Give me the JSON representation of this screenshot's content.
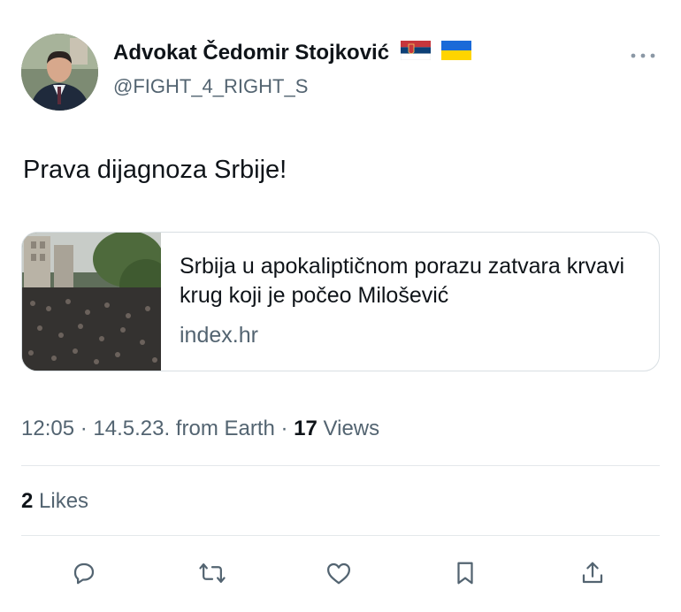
{
  "author": {
    "name": "Advokat Čedomir Stojković",
    "handle": "@FIGHT_4_RIGHT_S",
    "flags": [
      "serbia-flag-icon",
      "ukraine-flag-icon"
    ]
  },
  "more_icon": "more-icon",
  "tweet": {
    "text": "Prava dijagnoza Srbije!"
  },
  "link_card": {
    "title": "Srbija u apokaliptičnom porazu zatvara krvavi krug koji je počeo Milošević",
    "domain": "index.hr"
  },
  "meta": {
    "time": "12:05",
    "sep1": " · ",
    "date": "14.5.23.",
    "source": " from Earth",
    "sep2": " · ",
    "views_count": "17",
    "views_label": " Views"
  },
  "likes": {
    "count": "2",
    "label": " Likes"
  },
  "actions": [
    "reply-icon",
    "retweet-icon",
    "like-icon",
    "bookmark-icon",
    "share-icon"
  ],
  "colors": {
    "text": "#0f1419",
    "secondary": "#536471",
    "divider": "#e4e8eb"
  }
}
